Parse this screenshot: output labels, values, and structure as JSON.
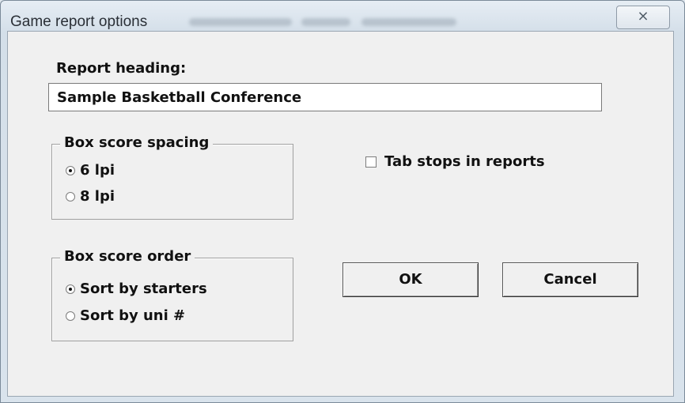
{
  "window": {
    "title": "Game report options",
    "close_glyph": "⨯"
  },
  "report_heading": {
    "label": "Report heading:",
    "value": "Sample Basketball Conference"
  },
  "box_score_spacing": {
    "legend": "Box score spacing",
    "options": [
      {
        "label": "6 lpi",
        "selected": true
      },
      {
        "label": "8 lpi",
        "selected": false
      }
    ]
  },
  "tab_stops": {
    "label": "Tab stops in reports",
    "checked": false
  },
  "box_score_order": {
    "legend": "Box score order",
    "options": [
      {
        "label": "Sort by starters",
        "selected": true
      },
      {
        "label": "Sort by uni #",
        "selected": false
      }
    ]
  },
  "buttons": {
    "ok": "OK",
    "cancel": "Cancel"
  }
}
